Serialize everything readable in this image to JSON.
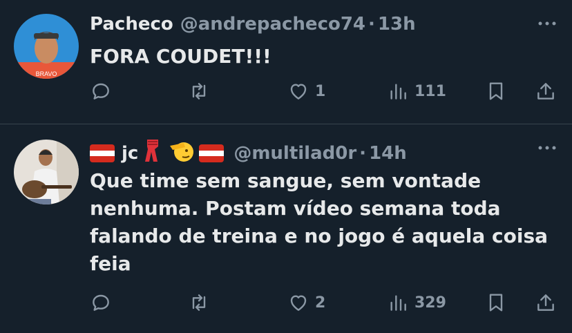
{
  "tweets": [
    {
      "name": "Pacheco",
      "handle": "@andrepacheco74",
      "separator": "·",
      "time": "13h",
      "text": "FORA COUDET!!!",
      "replies": "",
      "retweets": "",
      "likes": "1",
      "views": "111"
    },
    {
      "name": "jc",
      "handle": "@multilad0r",
      "separator": "·",
      "time": "14h",
      "text": "Que time sem sangue, sem vontade nenhuma. Postam vídeo semana toda falando de treina e no jogo é aquela coisa feia",
      "replies": "",
      "retweets": "",
      "likes": "2",
      "views": "329"
    }
  ],
  "icons": {
    "reply": "reply-icon",
    "retweet": "retweet-icon",
    "like": "heart-icon",
    "views": "views-icon",
    "bookmark": "bookmark-icon",
    "share": "share-icon",
    "more": "more-icon"
  },
  "colors": {
    "background": "#15202b",
    "text": "#e7e9ea",
    "muted": "#8b98a5",
    "divider": "#38444d"
  }
}
